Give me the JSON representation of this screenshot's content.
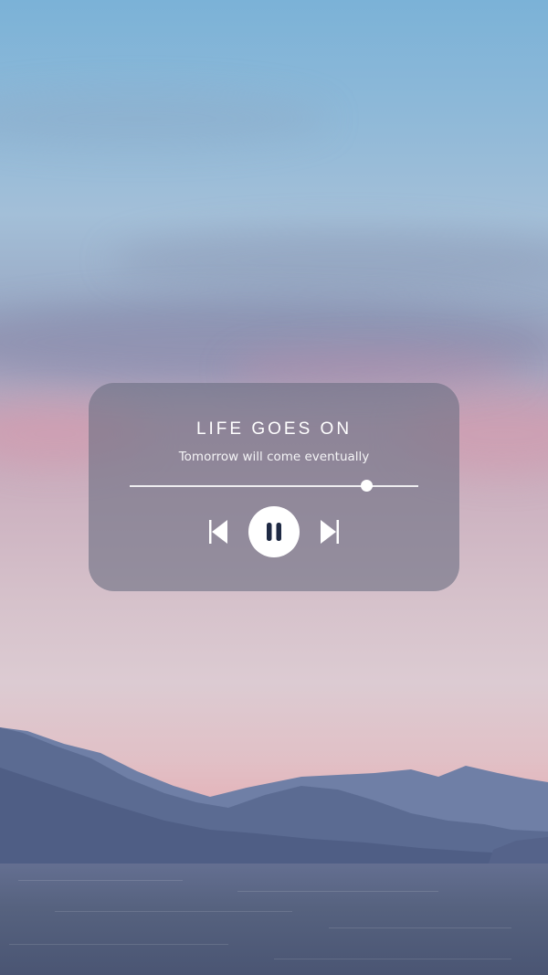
{
  "player": {
    "title": "LIFE GOES ON",
    "subtitle": "Tomorrow will come eventually",
    "progress": 0.82,
    "controls": {
      "previous_icon": "skip-previous-icon",
      "pause_icon": "pause-icon",
      "next_icon": "skip-next-icon"
    }
  },
  "colors": {
    "card_background": "#6c7082",
    "text": "#ffffff",
    "pause_glyph": "#1f2a44"
  }
}
